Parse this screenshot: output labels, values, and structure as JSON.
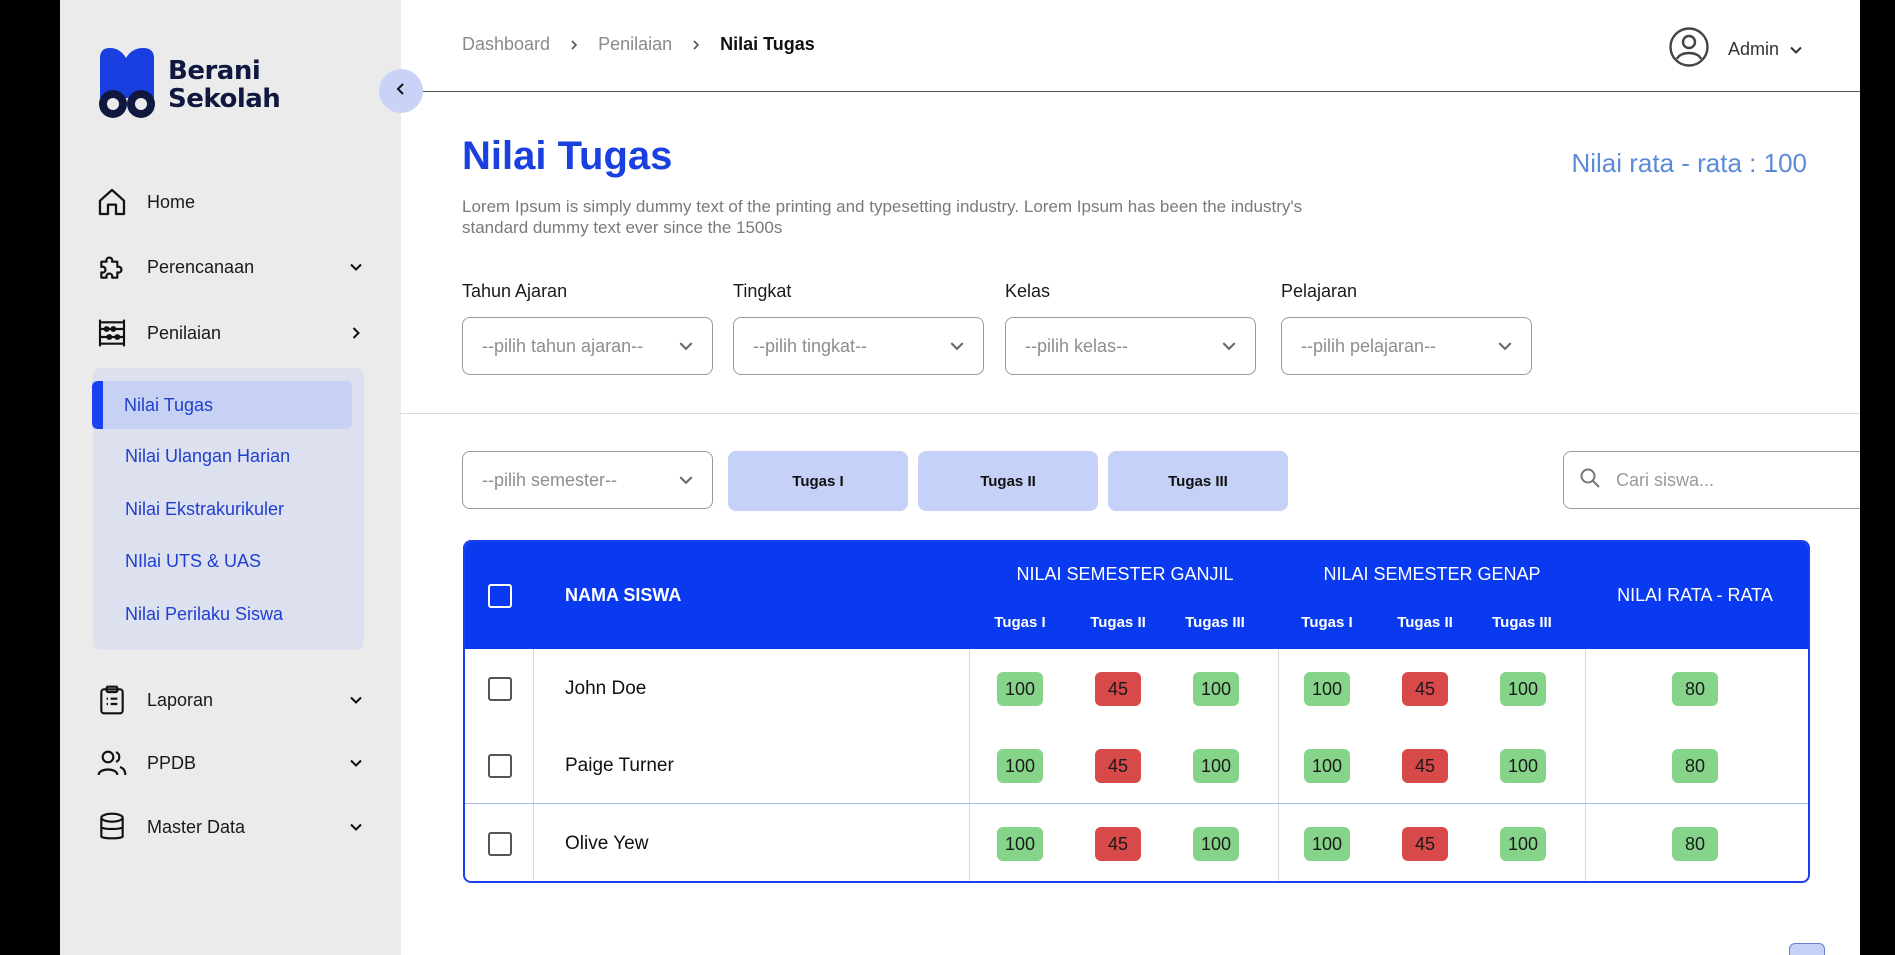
{
  "brand": {
    "line1": "Berani",
    "line2": "Sekolah"
  },
  "sidebar": {
    "items": [
      {
        "label": "Home",
        "icon": "home-icon"
      },
      {
        "label": "Perencanaan",
        "icon": "puzzle-icon"
      },
      {
        "label": "Penilaian",
        "icon": "abacus-icon"
      },
      {
        "label": "Laporan",
        "icon": "clipboard-icon"
      },
      {
        "label": "PPDB",
        "icon": "users-icon"
      },
      {
        "label": "Master Data",
        "icon": "database-icon"
      }
    ],
    "submenu": [
      {
        "label": "Nilai Tugas",
        "active": true
      },
      {
        "label": "Nilai Ulangan Harian"
      },
      {
        "label": "Nilai Ekstrakurikuler"
      },
      {
        "label": "NIlai UTS & UAS"
      },
      {
        "label": "Nilai Perilaku Siswa"
      }
    ]
  },
  "breadcrumb": [
    "Dashboard",
    "Penilaian",
    "Nilai Tugas"
  ],
  "user": {
    "name": "Admin"
  },
  "page": {
    "title": "Nilai Tugas",
    "average": "Nilai rata - rata : 100",
    "description": "Lorem Ipsum is simply dummy text of the printing and typesetting industry. Lorem Ipsum has been the industry's standard dummy text ever since the 1500s"
  },
  "filters": [
    {
      "label": "Tahun Ajaran",
      "placeholder": "--pilih tahun ajaran--"
    },
    {
      "label": "Tingkat",
      "placeholder": "--pilih tingkat--"
    },
    {
      "label": "Kelas",
      "placeholder": "--pilih kelas--"
    },
    {
      "label": "Pelajaran",
      "placeholder": "--pilih pelajaran--"
    }
  ],
  "semester": {
    "placeholder": "--pilih semester--"
  },
  "tabs": [
    "Tugas I",
    "Tugas II",
    "Tugas III"
  ],
  "search": {
    "placeholder": "Cari siswa..."
  },
  "table": {
    "headers": {
      "name": "NAMA SISWA",
      "ganjil": "NILAI SEMESTER GANJIL",
      "genap": "NILAI SEMESTER GENAP",
      "average": "NILAI RATA - RATA",
      "sub": [
        "Tugas I",
        "Tugas II",
        "Tugas III"
      ]
    },
    "rows": [
      {
        "name": "John Doe",
        "ganjil": [
          "100",
          "45",
          "100"
        ],
        "genap": [
          "100",
          "45",
          "100"
        ],
        "avg": "80"
      },
      {
        "name": "Paige Turner",
        "ganjil": [
          "100",
          "45",
          "100"
        ],
        "genap": [
          "100",
          "45",
          "100"
        ],
        "avg": "80"
      },
      {
        "name": "Olive Yew",
        "ganjil": [
          "100",
          "45",
          "100"
        ],
        "genap": [
          "100",
          "45",
          "100"
        ],
        "avg": "80"
      }
    ]
  },
  "colors": {
    "primary": "#0a3af0",
    "pass": "#86d48a",
    "fail": "#d84a4a",
    "tab": "#c6d1f8"
  }
}
